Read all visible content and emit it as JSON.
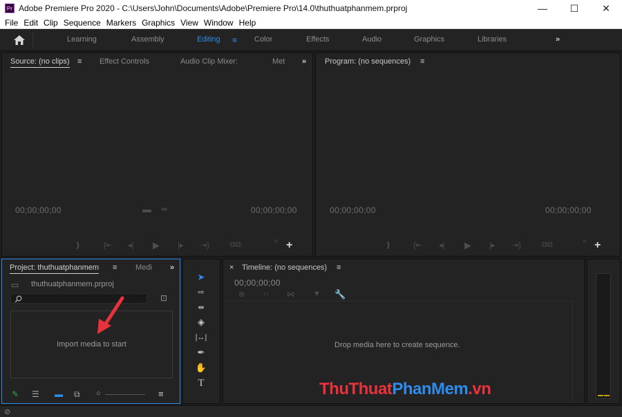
{
  "window": {
    "title": "Adobe Premiere Pro 2020 - C:\\Users\\John\\Documents\\Adobe\\Premiere Pro\\14.0\\thuthuatphanmem.prproj",
    "app_icon_text": "Pr",
    "minimize": "—",
    "maximize": "☐",
    "close": "✕"
  },
  "menu": [
    "File",
    "Edit",
    "Clip",
    "Sequence",
    "Markers",
    "Graphics",
    "View",
    "Window",
    "Help"
  ],
  "workspaces": {
    "items": [
      "Learning",
      "Assembly",
      "Editing",
      "Color",
      "Effects",
      "Audio",
      "Graphics",
      "Libraries"
    ],
    "active": "Editing",
    "more": "»"
  },
  "source": {
    "tabs": [
      "Source: (no clips)",
      "Effect Controls",
      "Audio Clip Mixer:",
      "Met"
    ],
    "timecode_left": "00;00;00;00",
    "timecode_right": "00;00;00;00",
    "more": "»"
  },
  "program": {
    "tab": "Program: (no sequences)",
    "timecode_left": "00;00;00;00",
    "timecode_right": "00;00;00;00"
  },
  "project": {
    "tabs": [
      "Project: thuthuatphanmem",
      "Medi"
    ],
    "filename": "thuthuatphanmem.prproj",
    "empty_text": "Import media to start",
    "more": "»"
  },
  "timeline": {
    "tab": "Timeline: (no sequences)",
    "timecode": "00;00;00;00",
    "empty_text": "Drop media here to create sequence."
  },
  "watermark": {
    "part1": "ThuThuat",
    "part2": "PhanMem",
    ".vn": ".vn"
  },
  "colors": {
    "accent": "#2d8ceb",
    "arrow": "#e8323c",
    "panel": "#232323",
    "border_active": "#2d8ceb"
  }
}
